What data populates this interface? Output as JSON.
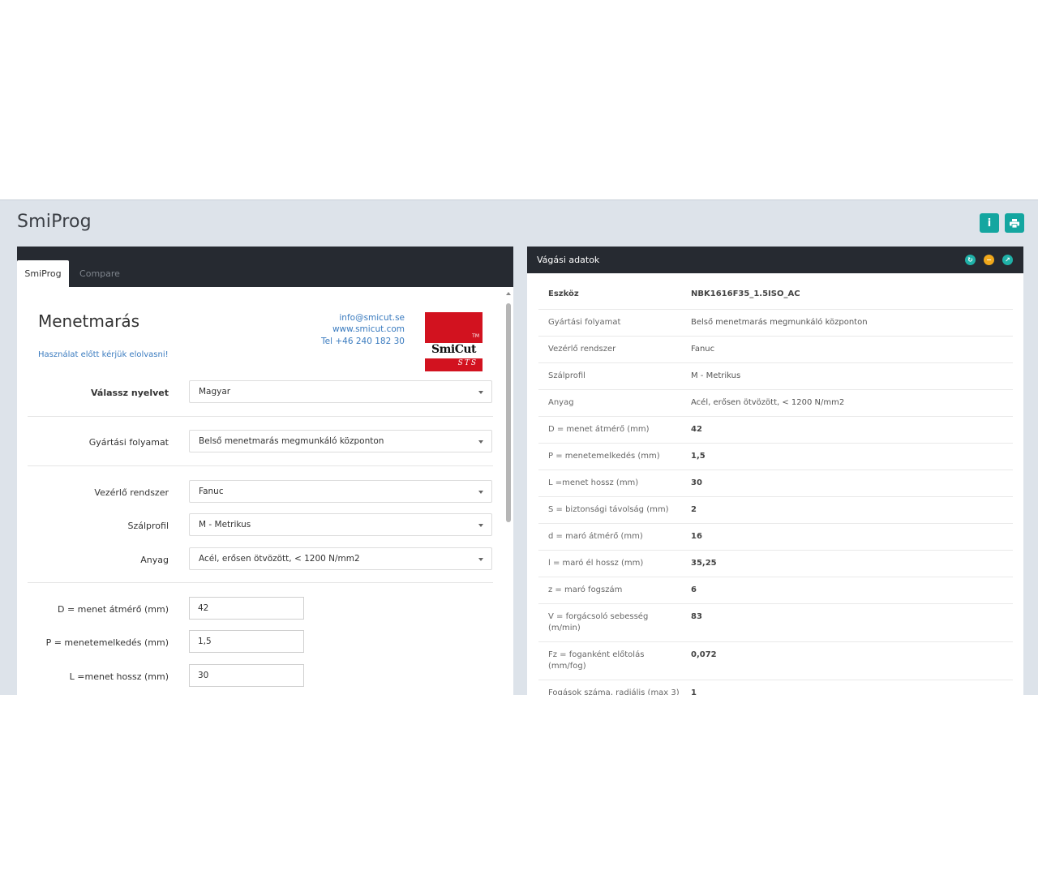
{
  "app": {
    "title": "SmiProg"
  },
  "header_buttons": {
    "info": "i",
    "print": "print-icon"
  },
  "tabs": [
    {
      "label": "SmiProg"
    },
    {
      "label": "Compare"
    }
  ],
  "intro": {
    "heading": "Menetmarás",
    "read_link": "Használat előtt kérjük elolvasni!",
    "email": "info@smicut.se",
    "website": "www.smicut.com",
    "phone": "Tel +46 240 182 30"
  },
  "logo": {
    "name": "SmiCut",
    "sub": "STS",
    "tm": "TM"
  },
  "form": {
    "language": {
      "label": "Válassz nyelvet",
      "value": "Magyar"
    },
    "process": {
      "label": "Gyártási folyamat",
      "value": "Belső menetmarás megmunkáló központon"
    },
    "control": {
      "label": "Vezérlő rendszer",
      "value": "Fanuc"
    },
    "profile": {
      "label": "Szálprofil",
      "value": "M - Metrikus"
    },
    "material": {
      "label": "Anyag",
      "value": "Acél, erősen ötvözött, < 1200 N/mm2"
    },
    "diameter": {
      "label": "D = menet átmérő (mm)",
      "value": "42"
    },
    "pitch": {
      "label": "P = menetemelkedés (mm)",
      "value": "1,5"
    },
    "length": {
      "label": "L =menet hossz (mm)",
      "value": "30"
    }
  },
  "cutting_panel": {
    "title": "Vágási adatok",
    "rows": [
      {
        "label": "Eszköz",
        "value": "NBK1616F35_1.5ISO_AC"
      },
      {
        "label": "Gyártási folyamat",
        "value": "Belső menetmarás megmunkáló központon"
      },
      {
        "label": "Vezérlő rendszer",
        "value": "Fanuc"
      },
      {
        "label": "Szálprofil",
        "value": "M - Metrikus"
      },
      {
        "label": "Anyag",
        "value": "Acél, erősen ötvözött, < 1200 N/mm2"
      },
      {
        "label": "D = menet átmérő (mm)",
        "value": "42"
      },
      {
        "label": "P = menetemelkedés (mm)",
        "value": "1,5"
      },
      {
        "label": "L =menet hossz (mm)",
        "value": "30"
      },
      {
        "label": "S = biztonsági távolság (mm)",
        "value": "2"
      },
      {
        "label": "d = maró átmérő (mm)",
        "value": "16"
      },
      {
        "label": "l = maró él hossz (mm)",
        "value": "35,25"
      },
      {
        "label": "z = maró fogszám",
        "value": "6"
      },
      {
        "label": "V = forgácsoló sebesség (m/min)",
        "value": "83"
      },
      {
        "label": "Fz = foganként előtolás (mm/fog)",
        "value": "0,072"
      },
      {
        "label": "Fogások száma, radiális (max 3)",
        "value": "1"
      }
    ]
  }
}
